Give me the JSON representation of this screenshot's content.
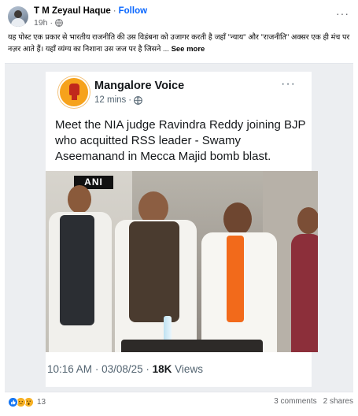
{
  "post": {
    "author_name": "T M Zeyaul Haque",
    "follow_label": "Follow",
    "timestamp": "19h",
    "caption": "यह पोस्ट एक प्रकार से भारतीय राजनीति की उस विडंबना को उजागर करती है जहाँ \"न्याय\" और \"राजनीति\" अक्सर एक ही मंच पर नज़र आते हैं। यहाँ व्यंग्य का निशाना उस जज पर है जिसने ...",
    "see_more_label": "See more",
    "more_options_label": "···"
  },
  "shared_image": {
    "account_name": "Mangalore Voice",
    "logo_text": "Mangalore Voice",
    "posted_ago": "12 mins",
    "more_label": "···",
    "headline": "Meet the NIA judge Ravindra Reddy joining BJP who acquitted RSS leader - Swamy Aseemanand in Mecca Majid bomb blast.",
    "photo_watermark": "ANI",
    "time": "10:16 AM",
    "date": "03/08/25",
    "views_count": "18K",
    "views_label": "Views"
  },
  "engagement": {
    "reaction_count": "13",
    "comments": "3 comments",
    "shares": "2 shares"
  },
  "icons": {
    "globe": "globe-icon",
    "like": "like-reaction-icon",
    "sad": "sad-reaction-icon",
    "wow": "wow-reaction-icon"
  },
  "colors": {
    "facebook_blue": "#0866ff",
    "secondary_text": "#65676b",
    "logo_orange": "#f6a21b"
  }
}
